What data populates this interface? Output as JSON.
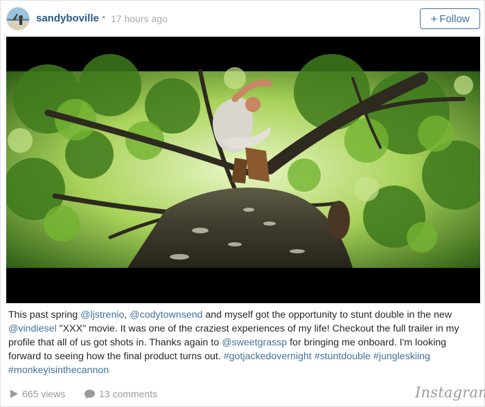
{
  "post": {
    "username": "sandyboville",
    "separator": "•",
    "timestamp": "17 hours ago",
    "follow_label": "Follow",
    "follow_icon": "plus-icon"
  },
  "caption": {
    "t1": "This past spring ",
    "m1": "@ljstrenio",
    "t2": ", ",
    "m2": "@codytownsend",
    "t3": " and myself got the opportunity to stunt double in the new ",
    "m3": "@vindiesel",
    "t4": " \"XXX\" movie. It was one of the craziest experiences of my life! Checkout the full trailer in my profile that all of us got shots in. Thanks again to ",
    "m4": "@sweetgrassp",
    "t5": " for bringing me onboard. I'm looking forward to seeing how the final product turns out. ",
    "h1": "#gotjackedovernight",
    "t6": " ",
    "h2": "#stuntdouble",
    "t7": " ",
    "h3": "#jungleskiing",
    "t8": " ",
    "h4": "#monkeyisinthecannon"
  },
  "footer": {
    "views": "665 views",
    "views_icon": "play-icon",
    "comments": "13 comments",
    "comments_icon": "comment-bubble-icon",
    "brand": "Instagram"
  },
  "colors": {
    "link": "#3f729b",
    "username": "#2c5a8a",
    "muted": "#aaaaaa"
  }
}
